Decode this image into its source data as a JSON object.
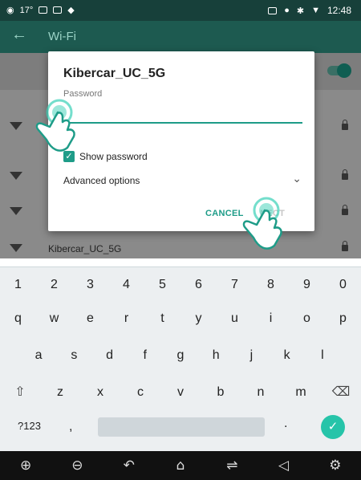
{
  "status_bar": {
    "temperature": "17°",
    "time": "12:48"
  },
  "app_bar": {
    "title": "Wi-Fi",
    "back_icon": "arrow-left-icon"
  },
  "background_list": {
    "visible_network": "Kibercar_UC_5G"
  },
  "dialog": {
    "title": "Kibercar_UC_5G",
    "password_label": "Password",
    "password_value": "",
    "show_password_label": "Show password",
    "show_password_checked": true,
    "advanced_options_label": "Advanced options",
    "cancel_label": "CANCEL",
    "connect_label": "NECT"
  },
  "keyboard": {
    "row_numbers": [
      "1",
      "2",
      "3",
      "4",
      "5",
      "6",
      "7",
      "8",
      "9",
      "0"
    ],
    "row_q": [
      "q",
      "w",
      "e",
      "r",
      "t",
      "y",
      "u",
      "i",
      "o",
      "p"
    ],
    "row_a": [
      "a",
      "s",
      "d",
      "f",
      "g",
      "h",
      "j",
      "k",
      "l"
    ],
    "row_z": [
      "z",
      "x",
      "c",
      "v",
      "b",
      "n",
      "m"
    ],
    "symbols_key": "?123",
    "comma": ",",
    "period": "."
  },
  "colors": {
    "accent": "#1e9c88",
    "enter": "#26c4a9",
    "status_bar": "#17403a",
    "app_bar": "#1d5a50"
  }
}
